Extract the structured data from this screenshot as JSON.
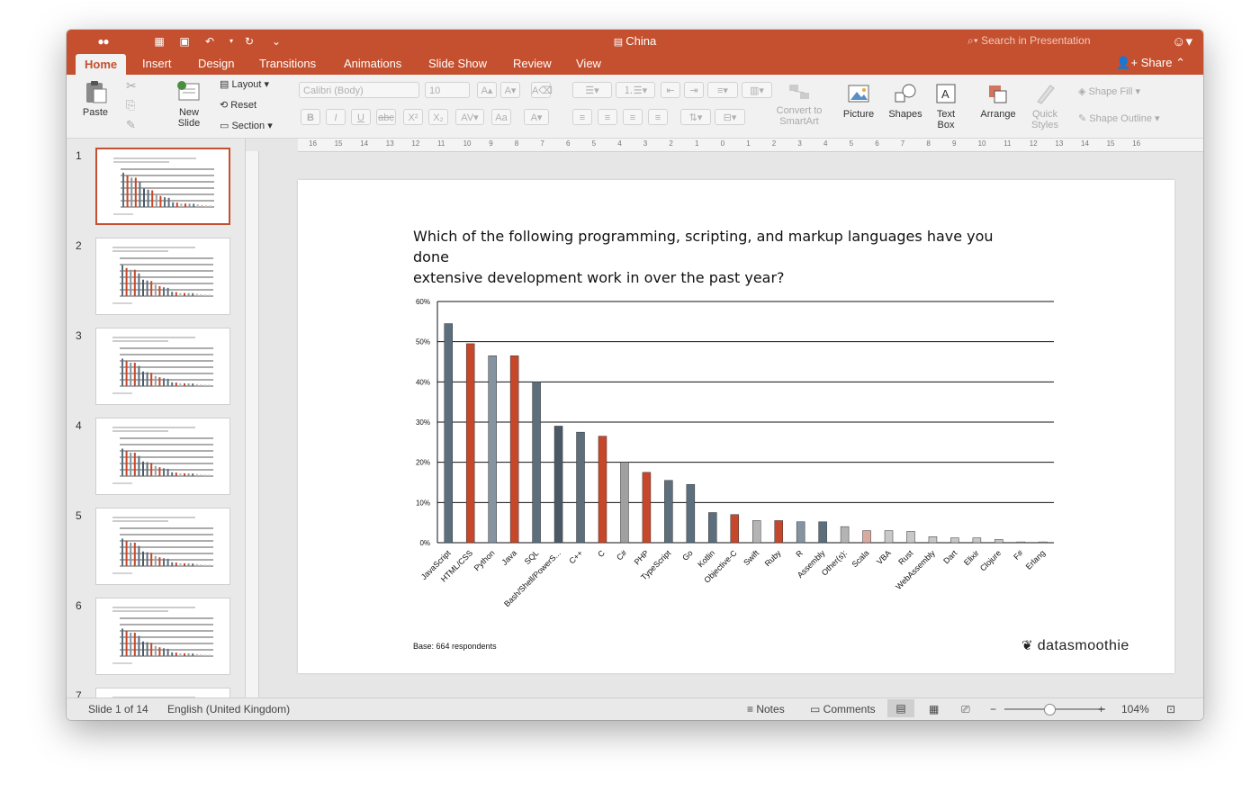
{
  "window": {
    "title": "China",
    "search_placeholder": "Search in Presentation"
  },
  "tabs": [
    "Home",
    "Insert",
    "Design",
    "Transitions",
    "Animations",
    "Slide Show",
    "Review",
    "View"
  ],
  "share_label": "Share",
  "ribbon": {
    "paste": "Paste",
    "new_slide": [
      "New",
      "Slide"
    ],
    "layout": "Layout",
    "reset": "Reset",
    "section": "Section",
    "font_name": "Calibri (Body)",
    "font_size": "10",
    "convert": [
      "Convert to",
      "SmartArt"
    ],
    "picture": "Picture",
    "shapes": "Shapes",
    "text_box": [
      "Text",
      "Box"
    ],
    "arrange": "Arrange",
    "quick_styles": [
      "Quick",
      "Styles"
    ],
    "shape_fill": "Shape Fill",
    "shape_outline": "Shape Outline"
  },
  "thumbnails": [
    "1",
    "2",
    "3",
    "4",
    "5",
    "6",
    "7"
  ],
  "ruler_labels": [
    "16",
    "15",
    "14",
    "13",
    "12",
    "11",
    "10",
    "9",
    "8",
    "7",
    "6",
    "5",
    "4",
    "3",
    "2",
    "1",
    "0",
    "1",
    "2",
    "3",
    "4",
    "5",
    "6",
    "7",
    "8",
    "9",
    "10",
    "11",
    "12",
    "13",
    "14",
    "15",
    "16"
  ],
  "slide": {
    "title_line1": "Which of the following programming, scripting, and markup languages have you done",
    "title_line2": "extensive development work in over the past year?",
    "base_note": "Base: 664 respondents",
    "logo_text": "datasmoothie"
  },
  "chart_data": {
    "type": "bar",
    "categories": [
      "JavaScript",
      "HTML/CSS",
      "Python",
      "Java",
      "SQL",
      "Bash/Shell/PowerS...",
      "C++",
      "C",
      "C#",
      "PHP",
      "TypeScript",
      "Go",
      "Kotlin",
      "Objective-C",
      "Swift",
      "Ruby",
      "R",
      "Assembly",
      "Other(s):",
      "Scala",
      "VBA",
      "Rust",
      "WebAssembly",
      "Dart",
      "Elixir",
      "Clojure",
      "F#",
      "Erlang"
    ],
    "values": [
      54.5,
      49.5,
      46.5,
      46.5,
      40,
      29,
      27.5,
      26.5,
      20,
      17.5,
      15.5,
      14.5,
      7.5,
      7,
      5.5,
      5.5,
      5.2,
      5.2,
      4,
      3,
      3,
      2.8,
      1.5,
      1.2,
      1.2,
      0.8,
      0.2,
      0.2
    ],
    "colors": [
      "#5d6f7d",
      "#c7472a",
      "#8594a0",
      "#c7472a",
      "#5d6f7d",
      "#4b5966",
      "#5d6f7d",
      "#c7472a",
      "#a0a0a0",
      "#c7472a",
      "#5d6f7d",
      "#5d6f7d",
      "#5d6f7d",
      "#c7472a",
      "#b4b4b4",
      "#c7472a",
      "#8594a0",
      "#5d6f7d",
      "#b4b4b4",
      "#d8aaa0",
      "#c8c8c8",
      "#c8c8c8",
      "#c8c8c8",
      "#c8c8c8",
      "#c8c8c8",
      "#c8c8c8",
      "#c8c8c8",
      "#c8c8c8"
    ],
    "yticks": [
      "0%",
      "10%",
      "20%",
      "30%",
      "40%",
      "50%",
      "60%"
    ],
    "ylim": [
      0,
      60
    ],
    "grid": true
  },
  "status": {
    "slide_counter": "Slide 1 of 14",
    "language": "English (United Kingdom)",
    "notes": "Notes",
    "comments": "Comments",
    "zoom": "104%"
  }
}
